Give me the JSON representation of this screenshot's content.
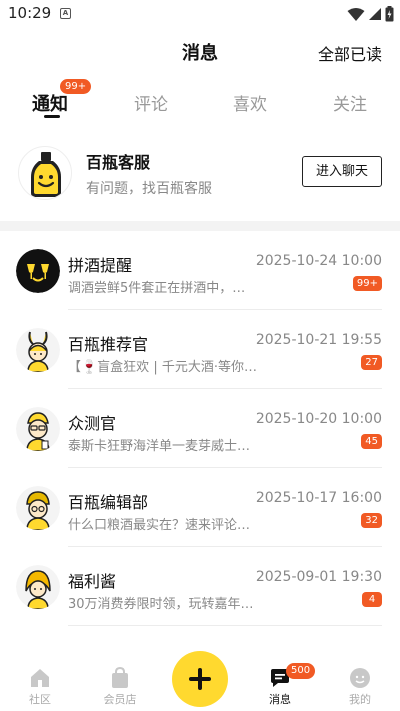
{
  "status_bar": {
    "time": "10:29",
    "notification_letter": "A"
  },
  "header": {
    "title": "消息",
    "read_all_label": "全部已读"
  },
  "tabs": [
    {
      "label": "通知",
      "active": true,
      "badge": "99+"
    },
    {
      "label": "评论",
      "active": false
    },
    {
      "label": "喜欢",
      "active": false
    },
    {
      "label": "关注",
      "active": false
    }
  ],
  "service": {
    "name": "百瓶客服",
    "description": "有问题，找百瓶客服",
    "chat_button_label": "进入聊天",
    "avatar_icon": "bottle-smiley-icon"
  },
  "messages": [
    {
      "title": "拼酒提醒",
      "time": "2025-10-24 10:00",
      "preview": "调酒尝鲜5件套正在拼酒中，…",
      "badge": "99+",
      "avatar_icon": "cheers-glasses-icon"
    },
    {
      "title": "百瓶推荐官",
      "time": "2025-10-21 19:55",
      "preview": "【🍷盲盒狂欢 | 千元大酒·等你…",
      "badge": "27",
      "avatar_icon": "bunny-mascot-icon"
    },
    {
      "title": "众测官",
      "time": "2025-10-20 10:00",
      "preview": "泰斯卡狂野海洋单一麦芽威士…",
      "badge": "45",
      "avatar_icon": "tester-mascot-icon"
    },
    {
      "title": "百瓶编辑部",
      "time": "2025-10-17 16:00",
      "preview": "什么口粮酒最实在？速来评论…",
      "badge": "32",
      "avatar_icon": "editor-mascot-icon"
    },
    {
      "title": "福利酱",
      "time": "2025-09-01 19:30",
      "preview": "30万消费券限时领，玩转嘉年…",
      "badge": "4",
      "avatar_icon": "welfare-mascot-icon"
    }
  ],
  "bottom_nav": {
    "items": [
      {
        "label": "社区",
        "icon": "home-icon"
      },
      {
        "label": "会员店",
        "icon": "shopping-bag-icon"
      },
      {
        "label": "消息",
        "icon": "chat-icon",
        "badge": "500",
        "active": true
      },
      {
        "label": "我的",
        "icon": "profile-face-icon"
      }
    ],
    "plus_icon": "plus-icon"
  },
  "colors": {
    "accent_yellow": "#ffd92f",
    "badge_orange": "#f15a24"
  }
}
